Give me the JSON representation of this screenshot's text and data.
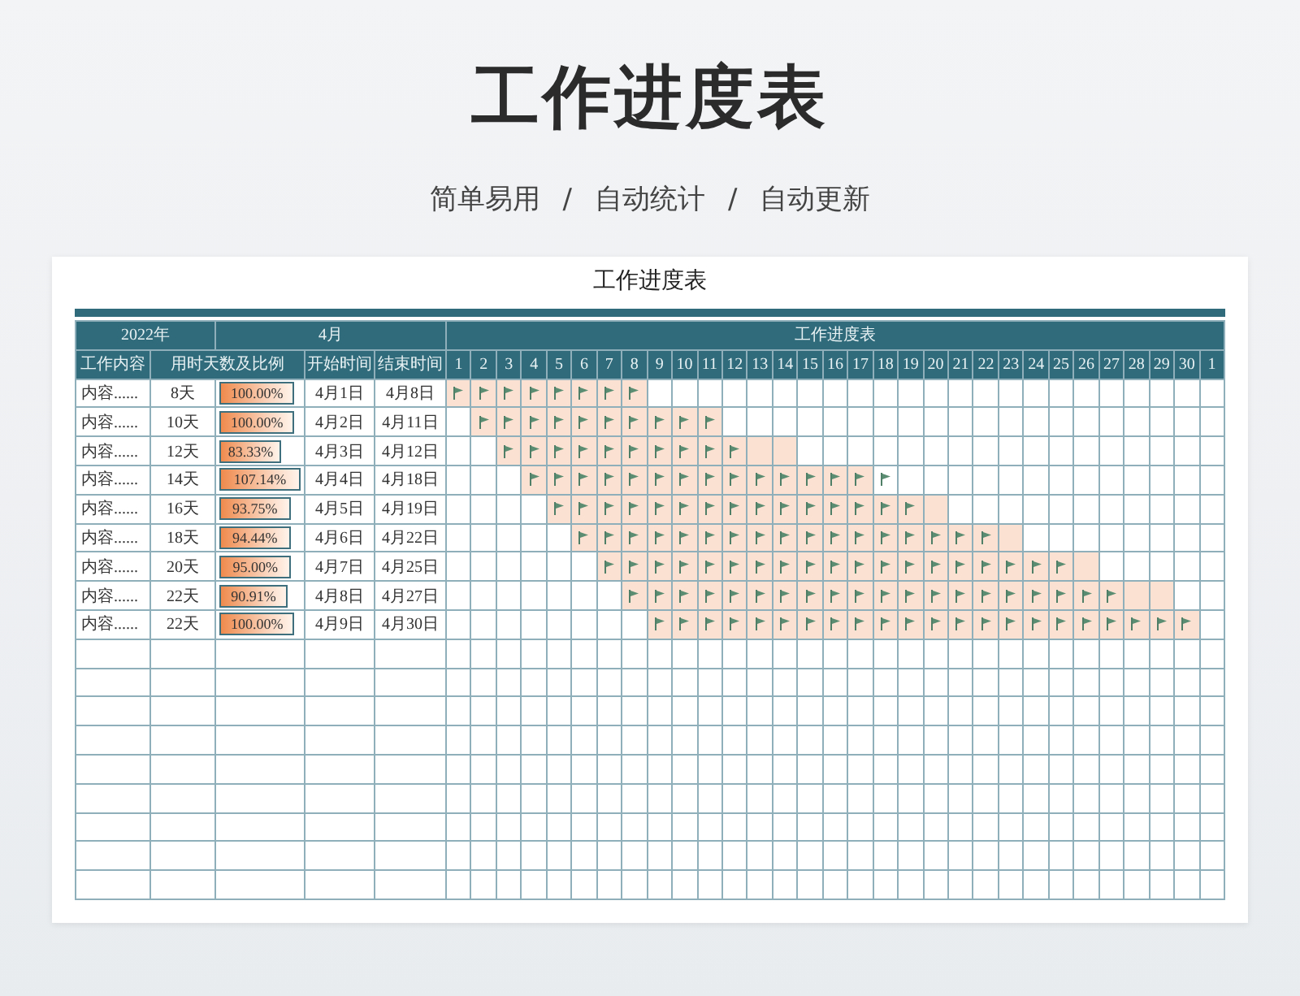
{
  "title": "工作进度表",
  "subtitle": [
    "简单易用",
    "/",
    "自动统计",
    "/",
    "自动更新"
  ],
  "sheet": {
    "title": "工作进度表",
    "header_top": [
      "2022年",
      "4月",
      "工作进度表"
    ],
    "columns": [
      "工作内容",
      "用时天数及比例",
      "开始时间",
      "结束时间"
    ],
    "day_labels": [
      "1",
      "2",
      "3",
      "4",
      "5",
      "6",
      "7",
      "8",
      "9",
      "10",
      "11",
      "12",
      "13",
      "14",
      "15",
      "16",
      "17",
      "18",
      "19",
      "20",
      "21",
      "22",
      "23",
      "24",
      "25",
      "26",
      "27",
      "28",
      "29",
      "30",
      "1"
    ],
    "tasks": [
      {
        "name": "内容......",
        "days": "8天",
        "ratio": "100.00%",
        "level": 0.89,
        "start": "4月1日",
        "end": "4月8日",
        "cells": [
          {
            "planned": true,
            "flag": true
          },
          {
            "planned": true,
            "flag": true
          },
          {
            "planned": true,
            "flag": true
          },
          {
            "planned": true,
            "flag": true
          },
          {
            "planned": true,
            "flag": true
          },
          {
            "planned": true,
            "flag": true
          },
          {
            "planned": true,
            "flag": true
          },
          {
            "planned": true,
            "flag": true
          },
          {
            "planned": false,
            "flag": false
          },
          {
            "planned": false,
            "flag": false
          },
          {
            "planned": false,
            "flag": false
          },
          {
            "planned": false,
            "flag": false
          },
          {
            "planned": false,
            "flag": false
          },
          {
            "planned": false,
            "flag": false
          },
          {
            "planned": false,
            "flag": false
          },
          {
            "planned": false,
            "flag": false
          },
          {
            "planned": false,
            "flag": false
          },
          {
            "planned": false,
            "flag": false
          },
          {
            "planned": false,
            "flag": false
          },
          {
            "planned": false,
            "flag": false
          },
          {
            "planned": false,
            "flag": false
          },
          {
            "planned": false,
            "flag": false
          },
          {
            "planned": false,
            "flag": false
          },
          {
            "planned": false,
            "flag": false
          },
          {
            "planned": false,
            "flag": false
          },
          {
            "planned": false,
            "flag": false
          },
          {
            "planned": false,
            "flag": false
          },
          {
            "planned": false,
            "flag": false
          },
          {
            "planned": false,
            "flag": false
          },
          {
            "planned": false,
            "flag": false
          },
          {
            "planned": false,
            "flag": false
          }
        ]
      },
      {
        "name": "内容......",
        "days": "10天",
        "ratio": "100.00%",
        "level": 0.89,
        "start": "4月2日",
        "end": "4月11日",
        "cells": [
          {
            "planned": false,
            "flag": false
          },
          {
            "planned": true,
            "flag": true
          },
          {
            "planned": true,
            "flag": true
          },
          {
            "planned": true,
            "flag": true
          },
          {
            "planned": true,
            "flag": true
          },
          {
            "planned": true,
            "flag": true
          },
          {
            "planned": true,
            "flag": true
          },
          {
            "planned": true,
            "flag": true
          },
          {
            "planned": true,
            "flag": true
          },
          {
            "planned": true,
            "flag": true
          },
          {
            "planned": true,
            "flag": true
          },
          {
            "planned": false,
            "flag": false
          },
          {
            "planned": false,
            "flag": false
          },
          {
            "planned": false,
            "flag": false
          },
          {
            "planned": false,
            "flag": false
          },
          {
            "planned": false,
            "flag": false
          },
          {
            "planned": false,
            "flag": false
          },
          {
            "planned": false,
            "flag": false
          },
          {
            "planned": false,
            "flag": false
          },
          {
            "planned": false,
            "flag": false
          },
          {
            "planned": false,
            "flag": false
          },
          {
            "planned": false,
            "flag": false
          },
          {
            "planned": false,
            "flag": false
          },
          {
            "planned": false,
            "flag": false
          },
          {
            "planned": false,
            "flag": false
          },
          {
            "planned": false,
            "flag": false
          },
          {
            "planned": false,
            "flag": false
          },
          {
            "planned": false,
            "flag": false
          },
          {
            "planned": false,
            "flag": false
          },
          {
            "planned": false,
            "flag": false
          },
          {
            "planned": false,
            "flag": false
          }
        ]
      },
      {
        "name": "内容......",
        "days": "12天",
        "ratio": "83.33%",
        "level": 0.74,
        "start": "4月3日",
        "end": "4月12日",
        "cells": [
          {
            "planned": false,
            "flag": false
          },
          {
            "planned": false,
            "flag": false
          },
          {
            "planned": true,
            "flag": true
          },
          {
            "planned": true,
            "flag": true
          },
          {
            "planned": true,
            "flag": true
          },
          {
            "planned": true,
            "flag": true
          },
          {
            "planned": true,
            "flag": true
          },
          {
            "planned": true,
            "flag": true
          },
          {
            "planned": true,
            "flag": true
          },
          {
            "planned": true,
            "flag": true
          },
          {
            "planned": true,
            "flag": true
          },
          {
            "planned": true,
            "flag": true
          },
          {
            "planned": true,
            "flag": false
          },
          {
            "planned": true,
            "flag": false
          },
          {
            "planned": false,
            "flag": false
          },
          {
            "planned": false,
            "flag": false
          },
          {
            "planned": false,
            "flag": false
          },
          {
            "planned": false,
            "flag": false
          },
          {
            "planned": false,
            "flag": false
          },
          {
            "planned": false,
            "flag": false
          },
          {
            "planned": false,
            "flag": false
          },
          {
            "planned": false,
            "flag": false
          },
          {
            "planned": false,
            "flag": false
          },
          {
            "planned": false,
            "flag": false
          },
          {
            "planned": false,
            "flag": false
          },
          {
            "planned": false,
            "flag": false
          },
          {
            "planned": false,
            "flag": false
          },
          {
            "planned": false,
            "flag": false
          },
          {
            "planned": false,
            "flag": false
          },
          {
            "planned": false,
            "flag": false
          },
          {
            "planned": false,
            "flag": false
          }
        ]
      },
      {
        "name": "内容......",
        "days": "14天",
        "ratio": "107.14%",
        "level": 0.96,
        "start": "4月4日",
        "end": "4月18日",
        "cells": [
          {
            "planned": false,
            "flag": false
          },
          {
            "planned": false,
            "flag": false
          },
          {
            "planned": false,
            "flag": false
          },
          {
            "planned": true,
            "flag": true
          },
          {
            "planned": true,
            "flag": true
          },
          {
            "planned": true,
            "flag": true
          },
          {
            "planned": true,
            "flag": true
          },
          {
            "planned": true,
            "flag": true
          },
          {
            "planned": true,
            "flag": true
          },
          {
            "planned": true,
            "flag": true
          },
          {
            "planned": true,
            "flag": true
          },
          {
            "planned": true,
            "flag": true
          },
          {
            "planned": true,
            "flag": true
          },
          {
            "planned": true,
            "flag": true
          },
          {
            "planned": true,
            "flag": true
          },
          {
            "planned": true,
            "flag": true
          },
          {
            "planned": true,
            "flag": true
          },
          {
            "planned": false,
            "flag": true
          },
          {
            "planned": false,
            "flag": false
          },
          {
            "planned": false,
            "flag": false
          },
          {
            "planned": false,
            "flag": false
          },
          {
            "planned": false,
            "flag": false
          },
          {
            "planned": false,
            "flag": false
          },
          {
            "planned": false,
            "flag": false
          },
          {
            "planned": false,
            "flag": false
          },
          {
            "planned": false,
            "flag": false
          },
          {
            "planned": false,
            "flag": false
          },
          {
            "planned": false,
            "flag": false
          },
          {
            "planned": false,
            "flag": false
          },
          {
            "planned": false,
            "flag": false
          },
          {
            "planned": false,
            "flag": false
          }
        ]
      },
      {
        "name": "内容......",
        "days": "16天",
        "ratio": "93.75%",
        "level": 0.84,
        "start": "4月5日",
        "end": "4月19日",
        "cells": [
          {
            "planned": false,
            "flag": false
          },
          {
            "planned": false,
            "flag": false
          },
          {
            "planned": false,
            "flag": false
          },
          {
            "planned": false,
            "flag": false
          },
          {
            "planned": true,
            "flag": true
          },
          {
            "planned": true,
            "flag": true
          },
          {
            "planned": true,
            "flag": true
          },
          {
            "planned": true,
            "flag": true
          },
          {
            "planned": true,
            "flag": true
          },
          {
            "planned": true,
            "flag": true
          },
          {
            "planned": true,
            "flag": true
          },
          {
            "planned": true,
            "flag": true
          },
          {
            "planned": true,
            "flag": true
          },
          {
            "planned": true,
            "flag": true
          },
          {
            "planned": true,
            "flag": true
          },
          {
            "planned": true,
            "flag": true
          },
          {
            "planned": true,
            "flag": true
          },
          {
            "planned": true,
            "flag": true
          },
          {
            "planned": true,
            "flag": true
          },
          {
            "planned": true,
            "flag": false
          },
          {
            "planned": false,
            "flag": false
          },
          {
            "planned": false,
            "flag": false
          },
          {
            "planned": false,
            "flag": false
          },
          {
            "planned": false,
            "flag": false
          },
          {
            "planned": false,
            "flag": false
          },
          {
            "planned": false,
            "flag": false
          },
          {
            "planned": false,
            "flag": false
          },
          {
            "planned": false,
            "flag": false
          },
          {
            "planned": false,
            "flag": false
          },
          {
            "planned": false,
            "flag": false
          },
          {
            "planned": false,
            "flag": false
          }
        ]
      },
      {
        "name": "内容......",
        "days": "18天",
        "ratio": "94.44%",
        "level": 0.84,
        "start": "4月6日",
        "end": "4月22日",
        "cells": [
          {
            "planned": false,
            "flag": false
          },
          {
            "planned": false,
            "flag": false
          },
          {
            "planned": false,
            "flag": false
          },
          {
            "planned": false,
            "flag": false
          },
          {
            "planned": false,
            "flag": false
          },
          {
            "planned": true,
            "flag": true
          },
          {
            "planned": true,
            "flag": true
          },
          {
            "planned": true,
            "flag": true
          },
          {
            "planned": true,
            "flag": true
          },
          {
            "planned": true,
            "flag": true
          },
          {
            "planned": true,
            "flag": true
          },
          {
            "planned": true,
            "flag": true
          },
          {
            "planned": true,
            "flag": true
          },
          {
            "planned": true,
            "flag": true
          },
          {
            "planned": true,
            "flag": true
          },
          {
            "planned": true,
            "flag": true
          },
          {
            "planned": true,
            "flag": true
          },
          {
            "planned": true,
            "flag": true
          },
          {
            "planned": true,
            "flag": true
          },
          {
            "planned": true,
            "flag": true
          },
          {
            "planned": true,
            "flag": true
          },
          {
            "planned": true,
            "flag": true
          },
          {
            "planned": true,
            "flag": false
          },
          {
            "planned": false,
            "flag": false
          },
          {
            "planned": false,
            "flag": false
          },
          {
            "planned": false,
            "flag": false
          },
          {
            "planned": false,
            "flag": false
          },
          {
            "planned": false,
            "flag": false
          },
          {
            "planned": false,
            "flag": false
          },
          {
            "planned": false,
            "flag": false
          },
          {
            "planned": false,
            "flag": false
          }
        ]
      },
      {
        "name": "内容......",
        "days": "20天",
        "ratio": "95.00%",
        "level": 0.85,
        "start": "4月7日",
        "end": "4月25日",
        "cells": [
          {
            "planned": false,
            "flag": false
          },
          {
            "planned": false,
            "flag": false
          },
          {
            "planned": false,
            "flag": false
          },
          {
            "planned": false,
            "flag": false
          },
          {
            "planned": false,
            "flag": false
          },
          {
            "planned": false,
            "flag": false
          },
          {
            "planned": true,
            "flag": true
          },
          {
            "planned": true,
            "flag": true
          },
          {
            "planned": true,
            "flag": true
          },
          {
            "planned": true,
            "flag": true
          },
          {
            "planned": true,
            "flag": true
          },
          {
            "planned": true,
            "flag": true
          },
          {
            "planned": true,
            "flag": true
          },
          {
            "planned": true,
            "flag": true
          },
          {
            "planned": true,
            "flag": true
          },
          {
            "planned": true,
            "flag": true
          },
          {
            "planned": true,
            "flag": true
          },
          {
            "planned": true,
            "flag": true
          },
          {
            "planned": true,
            "flag": true
          },
          {
            "planned": true,
            "flag": true
          },
          {
            "planned": true,
            "flag": true
          },
          {
            "planned": true,
            "flag": true
          },
          {
            "planned": true,
            "flag": true
          },
          {
            "planned": true,
            "flag": true
          },
          {
            "planned": true,
            "flag": true
          },
          {
            "planned": true,
            "flag": false
          },
          {
            "planned": false,
            "flag": false
          },
          {
            "planned": false,
            "flag": false
          },
          {
            "planned": false,
            "flag": false
          },
          {
            "planned": false,
            "flag": false
          },
          {
            "planned": false,
            "flag": false
          }
        ]
      },
      {
        "name": "内容......",
        "days": "22天",
        "ratio": "90.91%",
        "level": 0.81,
        "start": "4月8日",
        "end": "4月27日",
        "cells": [
          {
            "planned": false,
            "flag": false
          },
          {
            "planned": false,
            "flag": false
          },
          {
            "planned": false,
            "flag": false
          },
          {
            "planned": false,
            "flag": false
          },
          {
            "planned": false,
            "flag": false
          },
          {
            "planned": false,
            "flag": false
          },
          {
            "planned": false,
            "flag": false
          },
          {
            "planned": true,
            "flag": true
          },
          {
            "planned": true,
            "flag": true
          },
          {
            "planned": true,
            "flag": true
          },
          {
            "planned": true,
            "flag": true
          },
          {
            "planned": true,
            "flag": true
          },
          {
            "planned": true,
            "flag": true
          },
          {
            "planned": true,
            "flag": true
          },
          {
            "planned": true,
            "flag": true
          },
          {
            "planned": true,
            "flag": true
          },
          {
            "planned": true,
            "flag": true
          },
          {
            "planned": true,
            "flag": true
          },
          {
            "planned": true,
            "flag": true
          },
          {
            "planned": true,
            "flag": true
          },
          {
            "planned": true,
            "flag": true
          },
          {
            "planned": true,
            "flag": true
          },
          {
            "planned": true,
            "flag": true
          },
          {
            "planned": true,
            "flag": true
          },
          {
            "planned": true,
            "flag": true
          },
          {
            "planned": true,
            "flag": true
          },
          {
            "planned": true,
            "flag": true
          },
          {
            "planned": true,
            "flag": false
          },
          {
            "planned": true,
            "flag": false
          },
          {
            "planned": false,
            "flag": false
          },
          {
            "planned": false,
            "flag": false
          }
        ]
      },
      {
        "name": "内容......",
        "days": "22天",
        "ratio": "100.00%",
        "level": 0.89,
        "start": "4月9日",
        "end": "4月30日",
        "cells": [
          {
            "planned": false,
            "flag": false
          },
          {
            "planned": false,
            "flag": false
          },
          {
            "planned": false,
            "flag": false
          },
          {
            "planned": false,
            "flag": false
          },
          {
            "planned": false,
            "flag": false
          },
          {
            "planned": false,
            "flag": false
          },
          {
            "planned": false,
            "flag": false
          },
          {
            "planned": false,
            "flag": false
          },
          {
            "planned": true,
            "flag": true
          },
          {
            "planned": true,
            "flag": true
          },
          {
            "planned": true,
            "flag": true
          },
          {
            "planned": true,
            "flag": true
          },
          {
            "planned": true,
            "flag": true
          },
          {
            "planned": true,
            "flag": true
          },
          {
            "planned": true,
            "flag": true
          },
          {
            "planned": true,
            "flag": true
          },
          {
            "planned": true,
            "flag": true
          },
          {
            "planned": true,
            "flag": true
          },
          {
            "planned": true,
            "flag": true
          },
          {
            "planned": true,
            "flag": true
          },
          {
            "planned": true,
            "flag": true
          },
          {
            "planned": true,
            "flag": true
          },
          {
            "planned": true,
            "flag": true
          },
          {
            "planned": true,
            "flag": true
          },
          {
            "planned": true,
            "flag": true
          },
          {
            "planned": true,
            "flag": true
          },
          {
            "planned": true,
            "flag": true
          },
          {
            "planned": true,
            "flag": true
          },
          {
            "planned": true,
            "flag": true
          },
          {
            "planned": true,
            "flag": true
          },
          {
            "planned": false,
            "flag": false
          }
        ]
      }
    ]
  }
}
